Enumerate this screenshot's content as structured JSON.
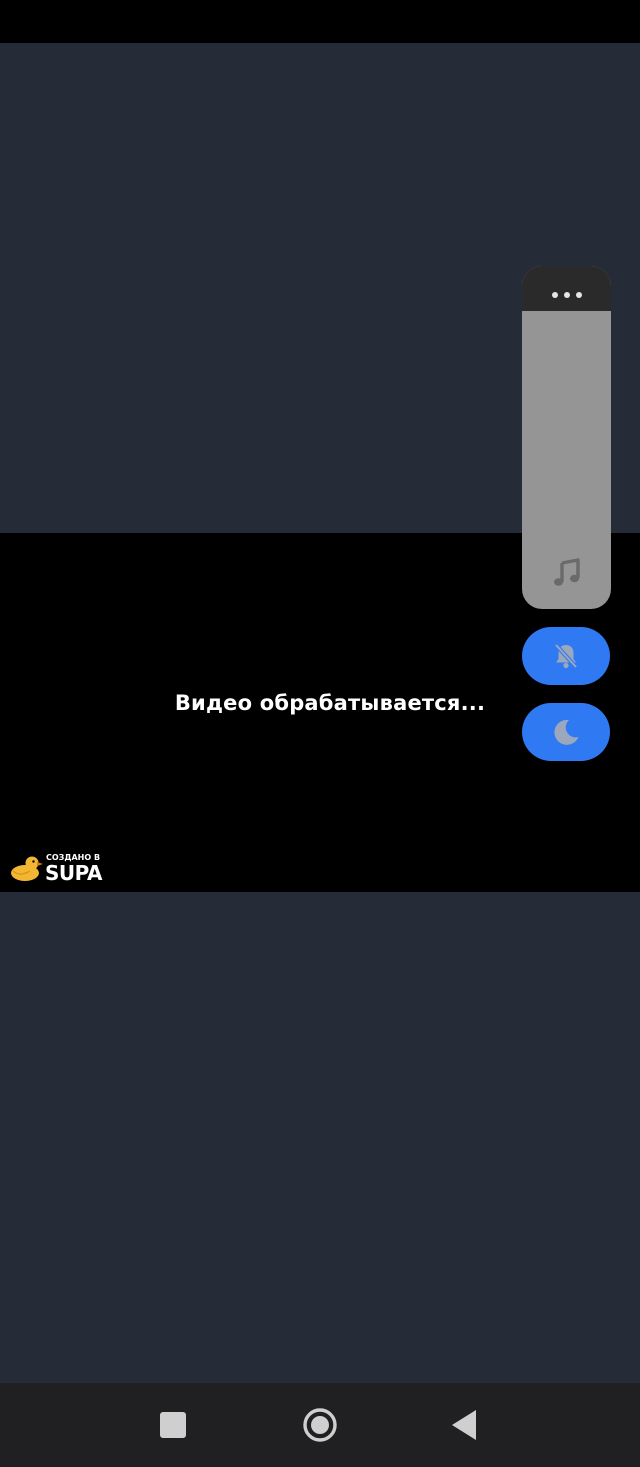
{
  "video": {
    "status_text": "Видео обрабатывается..."
  },
  "watermark": {
    "small_text": "СОЗДАНО В",
    "brand_text": "SUPA"
  },
  "side_panel": {
    "menu_icon": "more-horizontal-icon",
    "music_icon": "music-note-icon"
  },
  "buttons": {
    "mute_icon": "bell-off-icon",
    "night_icon": "moon-icon"
  },
  "nav": {
    "recents_icon": "square-icon",
    "home_icon": "circle-icon",
    "back_icon": "triangle-back-icon"
  },
  "colors": {
    "background": "#252b37",
    "video_background": "#000000",
    "accent": "#2f79f2",
    "panel": "#959595",
    "panel_header": "#2a2a2a",
    "duck": "#f2b632"
  }
}
